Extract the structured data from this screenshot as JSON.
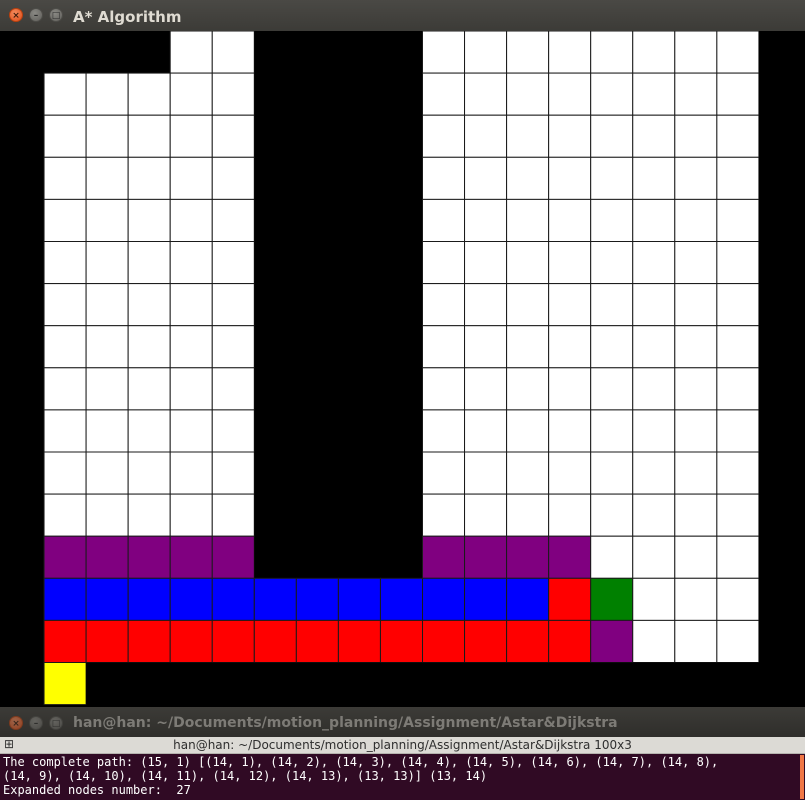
{
  "window": {
    "title": "A* Algorithm",
    "close_glyph": "×",
    "min_glyph": "–",
    "max_glyph": "□"
  },
  "grid": {
    "rows": 16,
    "cols": 19,
    "colors": {
      "K": "#000000",
      "W": "#ffffff",
      "P": "#800080",
      "B": "#0000ff",
      "R": "#ff0000",
      "G": "#008000",
      "Y": "#ffff00",
      "line": "#1a1a1a"
    },
    "cells": [
      "KKKKWWKKKKWWWWWWWWK",
      "KWWWWWKKKKWWWWWWWWK",
      "KWWWWWKKKKWWWWWWWWK",
      "KWWWWWKKKKWWWWWWWWK",
      "KWWWWWKKKKWWWWWWWWK",
      "KWWWWWKKKKWWWWWWWWK",
      "KWWWWWKKKKWWWWWWWWK",
      "KWWWWWKKKKWWWWWWWWK",
      "KWWWWWKKKKWWWWWWWWK",
      "KWWWWWKKKKWWWWWWWWK",
      "KWWWWWKKKKWWWWWWWWK",
      "KWWWWWKKKKWWWWWWWWK",
      "KPPPPPKKKKPPPPWWWWK",
      "KBBBBBBBBBBBBRGWWWK",
      "KRRRRRRRRRRRRRPWWWK",
      "KYKKKKKKKKKKKKKKKKK"
    ]
  },
  "terminal": {
    "title": "han@han: ~/Documents/motion_planning/Assignment/Astar&Dijkstra",
    "tab_label": "han@han: ~/Documents/motion_planning/Assignment/Astar&Dijkstra 100x3",
    "tab_icon": "⊞",
    "lines": [
      "The complete path: (15, 1) [(14, 1), (14, 2), (14, 3), (14, 4), (14, 5), (14, 6), (14, 7), (14, 8),",
      "(14, 9), (14, 10), (14, 11), (14, 12), (14, 13), (13, 13)] (13, 14)",
      "Expanded nodes number:  27"
    ]
  }
}
